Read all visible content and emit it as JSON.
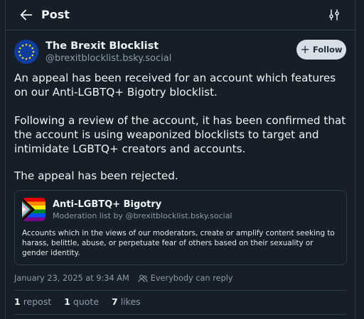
{
  "header": {
    "title": "Post"
  },
  "author": {
    "name": "The Brexit Blocklist",
    "handle": "@brexitblocklist.bsky.social",
    "follow_label": "Follow"
  },
  "post": {
    "paragraphs": [
      "An appeal has been received for an account which features on our Anti-LGBTQ+ Bigotry blocklist.",
      "Following a review of the account, it has been confirmed that the account is using weaponized blocklists to target and intimidate LGBTQ+ creators and accounts.",
      "The appeal has been rejected."
    ]
  },
  "embed": {
    "name": "Anti-LGBTQ+ Bigotry",
    "subtitle": "Moderation list by @brexitblocklist.bsky.social",
    "description": "Accounts which in the views of our moderators, create or amplify content seeking to harass, belittle, abuse, or perpetuate fear of others based on their sexuality or gender identity."
  },
  "meta": {
    "timestamp": "January 23, 2025 at 9:34 AM",
    "reply_setting": "Everybody can reply"
  },
  "stats": {
    "reposts": "1",
    "reposts_label": "repost",
    "quotes": "1",
    "quotes_label": "quote",
    "likes": "7",
    "likes_label": "likes"
  },
  "colors": {
    "background": "#161e27",
    "border": "#2c3a4a",
    "muted_text": "#8c9aab",
    "follow_button": "#d7dee6"
  },
  "icons": [
    "back-arrow-icon",
    "settings-sliders-icon",
    "eu-flag-avatar",
    "plus-icon",
    "progress-pride-flag-icon",
    "people-icon"
  ]
}
